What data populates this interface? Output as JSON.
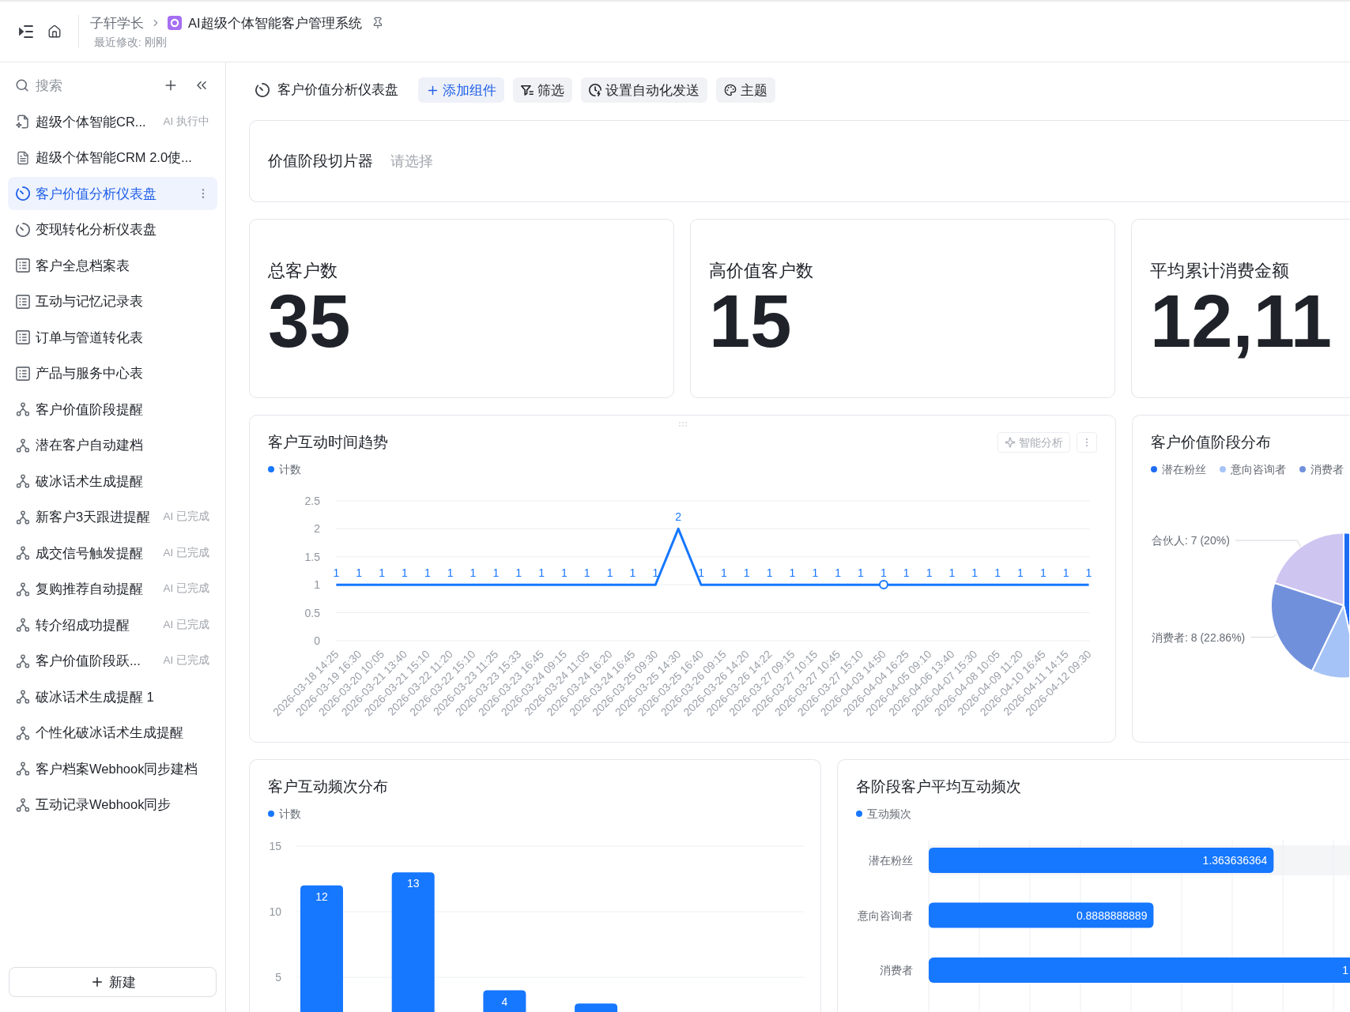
{
  "header": {
    "parent": "子轩学长",
    "title": "AI超级个体智能客户管理系统",
    "subtitle": "最近修改: 刚刚"
  },
  "sidebar": {
    "search": {
      "placeholder": "搜索"
    },
    "items": [
      {
        "kind": "ai-doc",
        "label": "超级个体智能CR...",
        "status": "AI 执行中",
        "selected": false
      },
      {
        "kind": "doc",
        "label": "超级个体智能CRM 2.0使...",
        "selected": false
      },
      {
        "kind": "dashboard",
        "label": "客户价值分析仪表盘",
        "selected": true
      },
      {
        "kind": "dashboard",
        "label": "变现转化分析仪表盘",
        "selected": false
      },
      {
        "kind": "table",
        "label": "客户全息档案表",
        "selected": false
      },
      {
        "kind": "table",
        "label": "互动与记忆记录表",
        "selected": false
      },
      {
        "kind": "table",
        "label": "订单与管道转化表",
        "selected": false
      },
      {
        "kind": "table",
        "label": "产品与服务中心表",
        "selected": false
      },
      {
        "kind": "workflow",
        "label": "客户价值阶段提醒",
        "selected": false
      },
      {
        "kind": "workflow",
        "label": "潜在客户自动建档",
        "selected": false
      },
      {
        "kind": "workflow",
        "label": "破冰话术生成提醒",
        "selected": false
      },
      {
        "kind": "workflow",
        "label": "新客户3天跟进提醒",
        "status": "AI 已完成",
        "selected": false
      },
      {
        "kind": "workflow",
        "label": "成交信号触发提醒",
        "status": "AI 已完成",
        "selected": false
      },
      {
        "kind": "workflow",
        "label": "复购推荐自动提醒",
        "status": "AI 已完成",
        "selected": false
      },
      {
        "kind": "workflow",
        "label": "转介绍成功提醒",
        "status": "AI 已完成",
        "selected": false
      },
      {
        "kind": "workflow",
        "label": "客户价值阶段跃...",
        "status": "AI 已完成",
        "selected": false
      },
      {
        "kind": "workflow",
        "label": "破冰话术生成提醒 1",
        "selected": false
      },
      {
        "kind": "workflow",
        "label": "个性化破冰话术生成提醒",
        "selected": false
      },
      {
        "kind": "workflow",
        "label": "客户档案Webhook同步建档",
        "selected": false
      },
      {
        "kind": "workflow",
        "label": "互动记录Webhook同步",
        "selected": false
      }
    ],
    "new_button": "新建"
  },
  "toolbar": {
    "title": "客户价值分析仪表盘",
    "buttons": [
      {
        "kind": "add",
        "label": "添加组件"
      },
      {
        "kind": "filter",
        "label": "筛选"
      },
      {
        "kind": "automation",
        "label": "设置自动化发送"
      },
      {
        "kind": "theme",
        "label": "主题"
      }
    ]
  },
  "slicer": {
    "label": "价值阶段切片器",
    "placeholder": "请选择"
  },
  "kpis": [
    {
      "label": "总客户数",
      "value": "35"
    },
    {
      "label": "高价值客户数",
      "value": "15"
    },
    {
      "label": "平均累计消费金额",
      "value": "12,11"
    }
  ],
  "trend_card": {
    "title": "客户互动时间趋势",
    "action": "智能分析",
    "chart_data": {
      "type": "line",
      "categories": [
        "2026-03-18 14:25",
        "2026-03-19 16:30",
        "2026-03-20 10:05",
        "2026-03-21 13:40",
        "2026-03-21 15:10",
        "2026-03-22 11:20",
        "2026-03-22 15:10",
        "2026-03-23 11:25",
        "2026-03-23 15:33",
        "2026-03-23 16:45",
        "2026-03-24 09:15",
        "2026-03-24 11:05",
        "2026-03-24 16:20",
        "2026-03-24 16:45",
        "2026-03-25 09:30",
        "2026-03-25 14:30",
        "2026-03-25 16:40",
        "2026-03-26 09:15",
        "2026-03-26 14:20",
        "2026-03-26 14:22",
        "2026-03-27 09:15",
        "2026-03-27 10:15",
        "2026-03-27 10:45",
        "2026-03-27 15:10",
        "2026-04-03 14:50",
        "2026-04-04 16:25",
        "2026-04-05 09:10",
        "2026-04-06 13:40",
        "2026-04-07 15:30",
        "2026-04-08 10:05",
        "2026-04-09 11:20",
        "2026-04-10 16:45",
        "2026-04-11 14:15",
        "2026-04-12 09:30"
      ],
      "series": [
        {
          "name": "计数",
          "color": "#1677ff",
          "values": [
            1,
            1,
            1,
            1,
            1,
            1,
            1,
            1,
            1,
            1,
            1,
            1,
            1,
            1,
            1,
            2,
            1,
            1,
            1,
            1,
            1,
            1,
            1,
            1,
            1,
            1,
            1,
            1,
            1,
            1,
            1,
            1,
            1,
            1
          ]
        }
      ],
      "ylim": [
        0,
        2.5
      ],
      "yticks": [
        0,
        0.5,
        1,
        1.5,
        2,
        2.5
      ],
      "grid": true,
      "data_labels": true
    }
  },
  "stage_card": {
    "title": "客户价值阶段分布",
    "legend": [
      {
        "label": "潜在粉丝",
        "color": "#1f6cf4"
      },
      {
        "label": "意向咨询者",
        "color": "#a6c3f7"
      },
      {
        "label": "消费者",
        "color": "#7190dc"
      }
    ],
    "slices": [
      {
        "color": "#cfc5f1",
        "label": "合伙人: 7 (20%)"
      },
      {
        "color": "#1f6cf4"
      },
      {
        "color": "#7190dc",
        "label": "消费者: 8 (22.86%)"
      },
      {
        "color": "#a6c3f7"
      }
    ]
  },
  "frequency_card": {
    "title": "客户互动频次分布",
    "chart_data": {
      "type": "bar",
      "series": [
        {
          "name": "计数",
          "color": "#1677ff",
          "values": [
            12,
            13,
            4,
            3
          ]
        }
      ],
      "ylim": [
        2.35,
        15
      ],
      "yticks": [
        {
          "value": 5,
          "label": "5"
        },
        {
          "value": 10,
          "label": "10"
        },
        {
          "value": 15,
          "label": "15"
        }
      ],
      "grid": true,
      "value_labels": [
        "12",
        "13",
        "4",
        null
      ]
    }
  },
  "stage_average_card": {
    "title": "各阶段客户平均互动频次",
    "chart_data": {
      "type": "bar",
      "orientation": "horizontal",
      "categories": [
        "潜在粉丝",
        "意向咨询者",
        "消费者"
      ],
      "series": [
        {
          "name": "互动频次",
          "color": "#1677ff",
          "values": [
            1.363636364,
            0.8888888889,
            null
          ]
        }
      ],
      "grid": true,
      "data_labels": true,
      "value_labels": [
        null,
        null,
        "1"
      ]
    }
  }
}
